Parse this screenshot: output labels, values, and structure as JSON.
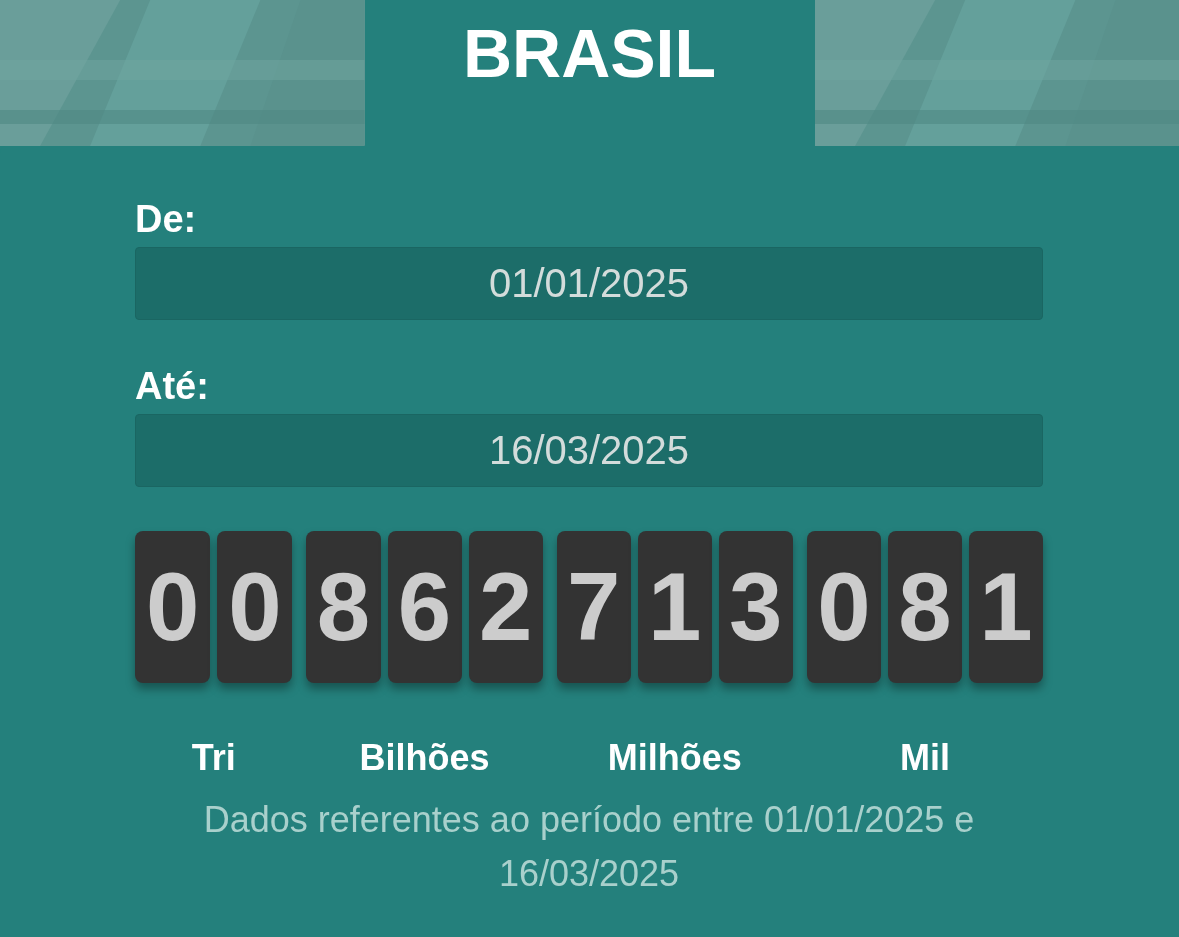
{
  "title": "BRASIL",
  "fields": [
    {
      "label": "De:",
      "value": "01/01/2025"
    },
    {
      "label": "Até:",
      "value": "16/03/2025"
    }
  ],
  "counter": [
    {
      "label": "Tri",
      "digits": [
        "0",
        "0"
      ]
    },
    {
      "label": "Bilhões",
      "digits": [
        "8",
        "6",
        "2"
      ]
    },
    {
      "label": "Milhões",
      "digits": [
        "7",
        "1",
        "3"
      ]
    },
    {
      "label": "Mil",
      "digits": [
        "0",
        "8",
        "1"
      ]
    }
  ],
  "caption": "Dados referentes ao período entre 01/01/2025 e 16/03/2025"
}
